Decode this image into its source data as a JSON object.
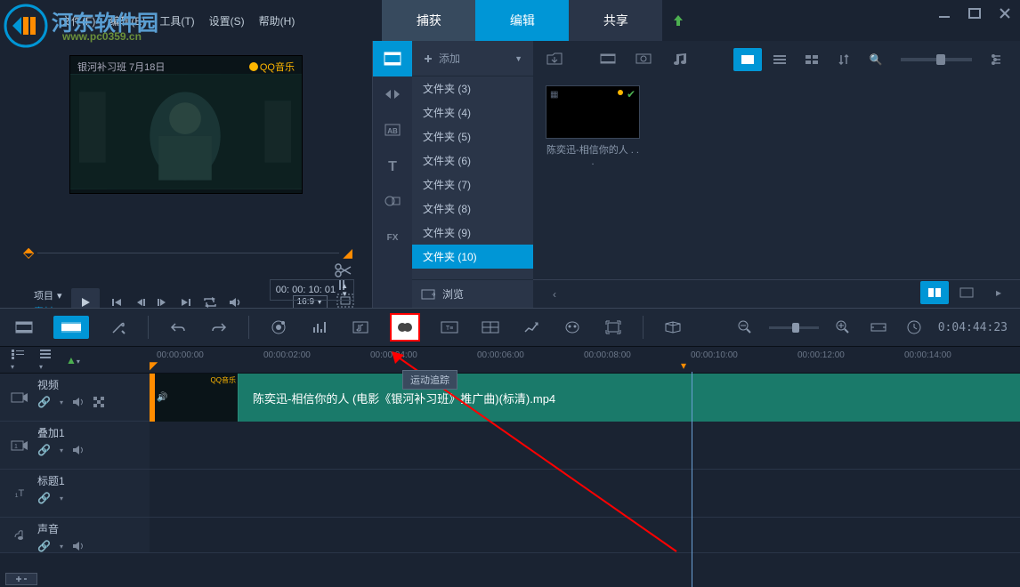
{
  "watermark": {
    "logo_text": "河东软件园",
    "logo_sub": "www.pc0359.cn"
  },
  "menu": {
    "file": "文件(F)",
    "edit": "编辑(E)",
    "tools": "工具(T)",
    "settings": "设置(S)",
    "help": "帮助(H)"
  },
  "tabs": {
    "capture": "捕获",
    "edit": "编辑",
    "share": "共享"
  },
  "preview": {
    "overlay_left": "银河补习班  7月18日",
    "overlay_right": "QQ音乐",
    "label_project": "项目",
    "label_clip": "素材",
    "aspect": "16:9",
    "timecode": "00: 00: 10: 01"
  },
  "library": {
    "add": "添加",
    "browse": "浏览",
    "folders": [
      "文件夹  (3)",
      "文件夹  (4)",
      "文件夹  (5)",
      "文件夹  (6)",
      "文件夹  (7)",
      "文件夹  (8)",
      "文件夹  (9)",
      "文件夹  (10)"
    ],
    "thumb_label": "陈奕迅-相信你的人 . . ."
  },
  "timeline": {
    "timecode": "0:04:44:23",
    "ruler_marks": [
      "00:00:00:00",
      "00:00:02:00",
      "00:00:04:00",
      "00:00:06:00",
      "00:00:08:00",
      "00:00:10:00",
      "00:00:12:00",
      "00:00:14:00"
    ],
    "tooltip": "运动追踪"
  },
  "tracks": {
    "video": "视频",
    "overlay": "叠加1",
    "title": "标题1",
    "audio": "声音",
    "clip_label": "陈奕迅-相信你的人 (电影《银河补习班》推广曲)(标清).mp4"
  }
}
